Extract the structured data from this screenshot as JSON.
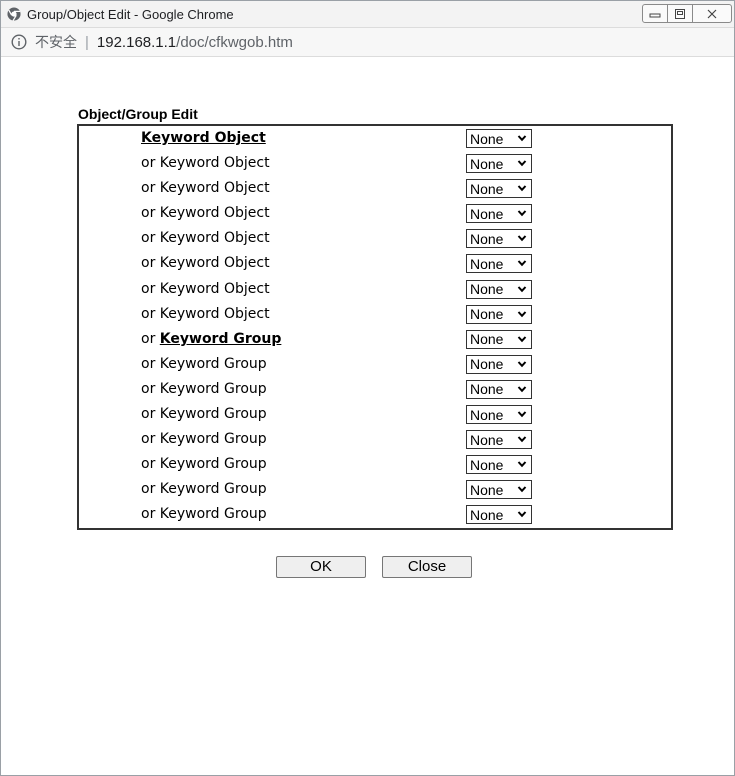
{
  "window": {
    "title": "Group/Object Edit - Google Chrome"
  },
  "address": {
    "security_label": "不安全",
    "url_host": "192.168.1.1",
    "url_path": "/doc/cfkwgob.htm"
  },
  "form": {
    "title": "Object/Group Edit",
    "rows": [
      {
        "prefix": "",
        "link": "Keyword Object",
        "text": "",
        "value": "None"
      },
      {
        "prefix": "",
        "link": "",
        "text": "or Keyword Object",
        "value": "None"
      },
      {
        "prefix": "",
        "link": "",
        "text": "or Keyword Object",
        "value": "None"
      },
      {
        "prefix": "",
        "link": "",
        "text": "or Keyword Object",
        "value": "None"
      },
      {
        "prefix": "",
        "link": "",
        "text": "or Keyword Object",
        "value": "None"
      },
      {
        "prefix": "",
        "link": "",
        "text": "or Keyword Object",
        "value": "None"
      },
      {
        "prefix": "",
        "link": "",
        "text": "or Keyword Object",
        "value": "None"
      },
      {
        "prefix": "",
        "link": "",
        "text": "or Keyword Object",
        "value": "None"
      },
      {
        "prefix": "or ",
        "link": "Keyword Group",
        "text": "",
        "value": "None"
      },
      {
        "prefix": "",
        "link": "",
        "text": "or Keyword Group",
        "value": "None"
      },
      {
        "prefix": "",
        "link": "",
        "text": "or Keyword Group",
        "value": "None"
      },
      {
        "prefix": "",
        "link": "",
        "text": "or Keyword Group",
        "value": "None"
      },
      {
        "prefix": "",
        "link": "",
        "text": "or Keyword Group",
        "value": "None"
      },
      {
        "prefix": "",
        "link": "",
        "text": "or Keyword Group",
        "value": "None"
      },
      {
        "prefix": "",
        "link": "",
        "text": "or Keyword Group",
        "value": "None"
      },
      {
        "prefix": "",
        "link": "",
        "text": "or Keyword Group",
        "value": "None"
      }
    ]
  },
  "buttons": {
    "ok_label": "OK",
    "close_label": "Close"
  }
}
